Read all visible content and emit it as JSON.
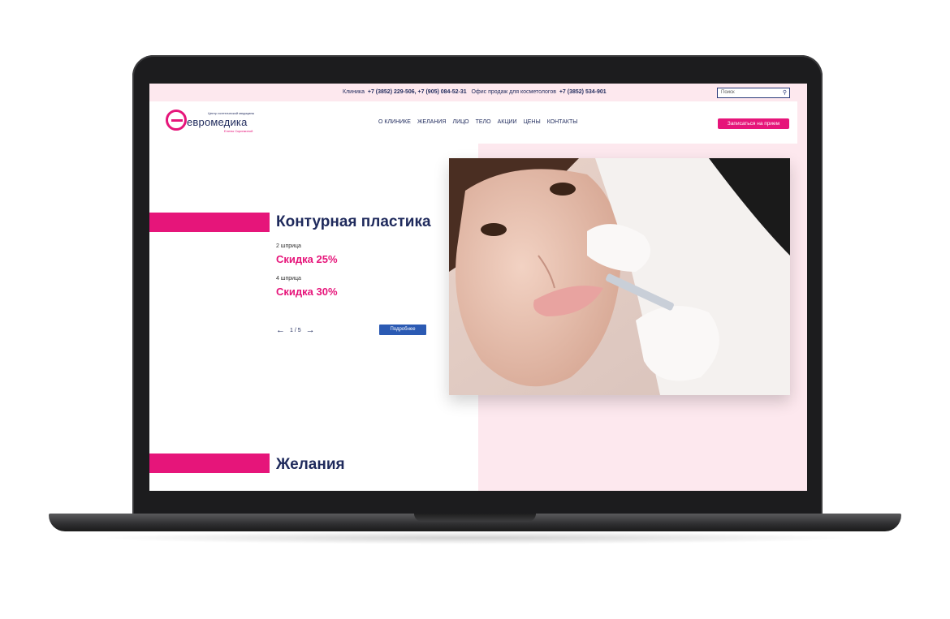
{
  "topbar": {
    "clinic_label": "Клиника",
    "clinic_phones": "+7 (3852) 229-506, +7 (905) 084-52-31",
    "office_label": "Офис продаж для косметологов",
    "office_phone": "+7 (3852) 534-901",
    "search_placeholder": "Поиск"
  },
  "logo": {
    "brand": "евромедика",
    "tagline_top": "Центр эстетической медицины",
    "tagline_bottom": "Елены Скрипкиной"
  },
  "nav": {
    "items": [
      "О КЛИНИКЕ",
      "ЖЕЛАНИЯ",
      "ЛИЦО",
      "ТЕЛО",
      "АКЦИИ",
      "ЦЕНЫ",
      "КОНТАКТЫ"
    ]
  },
  "header": {
    "cta": "Записаться на прием"
  },
  "slide": {
    "title": "Контурная пластика",
    "offers": [
      {
        "label": "2 шприца",
        "discount": "Скидка 25%"
      },
      {
        "label": "4 шприца",
        "discount": "Скидка 30%"
      }
    ],
    "pager": "1 / 5",
    "more_button": "Подробнее"
  },
  "section": {
    "title": "Желания"
  },
  "colors": {
    "accent": "#e6157a",
    "navy": "#1f2a5c",
    "button_blue": "#2b5ab3",
    "panel_pink": "#fde8ee"
  }
}
